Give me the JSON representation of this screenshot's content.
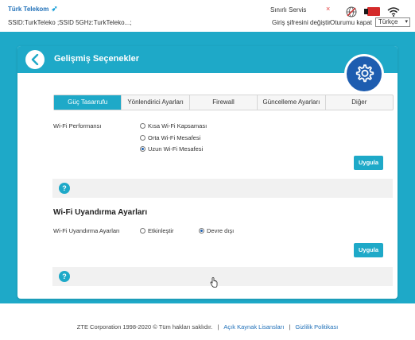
{
  "header": {
    "brand": "Türk Telekom",
    "ssid_line": "SSID:TurkTeleko  ;SSID 5GHz:TurkTeleko...;",
    "service_label": "Sınırlı Servis",
    "close_symbol": "×",
    "change_password_link": "Giriş şifresini değiştir",
    "logout_link": "Oturumu kapat",
    "language_value": "Türkçe",
    "icons": [
      "globe-icon",
      "sim-card-icon",
      "wifi-icon"
    ]
  },
  "page": {
    "title": "Gelişmiş Seçenekler",
    "tabs": [
      {
        "label": "Güç Tasarrufu",
        "active": true
      },
      {
        "label": "Yönlendirici Ayarları",
        "active": false
      },
      {
        "label": "Firewall",
        "active": false
      },
      {
        "label": "Güncelleme Ayarları",
        "active": false
      },
      {
        "label": "Diğer",
        "active": false
      }
    ],
    "wifi_performance": {
      "label": "Wi-Fi Performansı",
      "options": [
        {
          "label": "Kısa Wi-Fi Kapsaması",
          "selected": false
        },
        {
          "label": "Orta Wi-Fi Mesafesi",
          "selected": false
        },
        {
          "label": "Uzun Wi-Fi Mesafesi",
          "selected": true
        }
      ],
      "apply_label": "Uygula"
    },
    "wifi_wake": {
      "section_title": "Wi-Fi Uyandırma Ayarları",
      "label": "Wi-Fi Uyandırma Ayarları",
      "options": [
        {
          "label": "Etkinleştir",
          "selected": false
        },
        {
          "label": "Devre dışı",
          "selected": true
        }
      ],
      "apply_label": "Uygula"
    },
    "help_symbol": "?"
  },
  "footer": {
    "copyright": "ZTE Corporation 1998-2020 © Tüm hakları saklıdır.",
    "separator": "|",
    "open_source_link": "Açık Kaynak Lisansları",
    "privacy_link": "Gizlilik Politikası"
  },
  "colors": {
    "accent": "#1ea9c8",
    "gear_bg": "#1e5db0",
    "sim_red": "#d42b2b"
  }
}
